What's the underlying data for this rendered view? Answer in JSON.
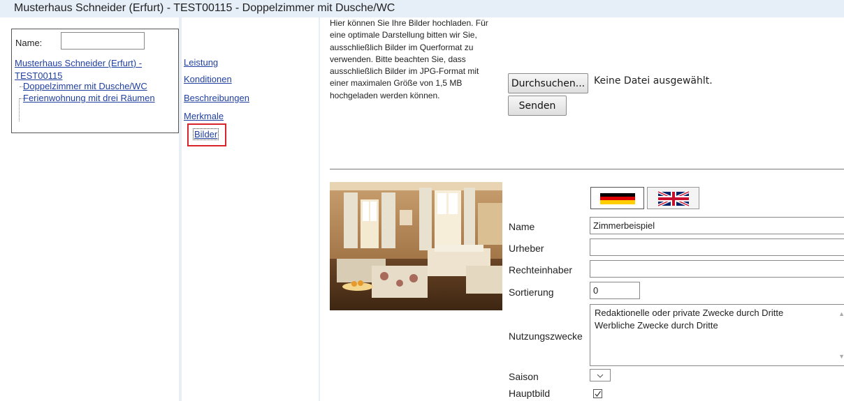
{
  "header": {
    "title": "Musterhaus Schneider (Erfurt) - TEST00115 - Doppelzimmer mit Dusche/WC"
  },
  "tree": {
    "name_label": "Name:",
    "name_value": "",
    "root_label": "Musterhaus Schneider (Erfurt) - TEST00115",
    "children": [
      "Doppelzimmer mit Dusche/WC",
      "Ferienwohnung mit drei Räumen"
    ]
  },
  "nav": {
    "items": [
      "Leistung",
      "Konditionen",
      "Beschreibungen",
      "Merkmale"
    ],
    "active": "Bilder"
  },
  "upload": {
    "help_text": "Hier können Sie Ihre Bilder hochladen. Für eine optimale Darstellung bitten wir Sie, ausschließlich Bilder im Querformat zu verwenden. Bitte beachten Sie, dass ausschließlich Bilder im JPG-Format mit einer maximalen Größe von 1,5 MB hochgeladen werden können.",
    "browse_label": "Durchsuchen...",
    "file_status": "Keine Datei ausgewählt.",
    "send_label": "Senden"
  },
  "form": {
    "name_label": "Name",
    "name_value": "Zimmerbeispiel",
    "urheber_label": "Urheber",
    "urheber_value": "",
    "rechte_label": "Rechteinhaber",
    "rechte_value": "",
    "sort_label": "Sortierung",
    "sort_value": "0",
    "nutzung_label": "Nutzungszwecke",
    "nutzung_options": [
      "Redaktionelle oder private Zwecke durch Dritte",
      "Werbliche Zwecke durch Dritte"
    ],
    "saison_label": "Saison",
    "saison_value": "",
    "hauptbild_label": "Hauptbild",
    "hauptbild_checked": true
  },
  "icons": {
    "flag_de": "german-flag-icon",
    "flag_uk": "uk-flag-icon",
    "chevron": "chevron-down-icon",
    "check": "checkmark-icon"
  },
  "colors": {
    "header_bg": "#e6eef8",
    "link": "#1f3fa0",
    "active_border": "#d9232a"
  }
}
